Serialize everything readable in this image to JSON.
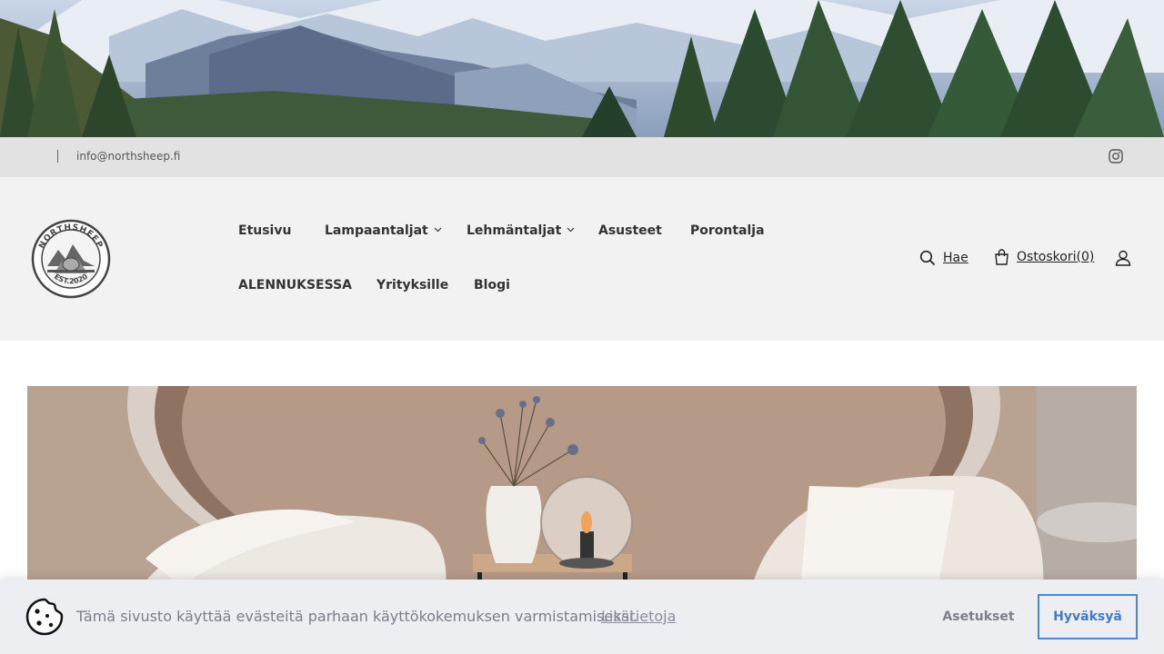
{
  "topbar": {
    "email": "info@northsheep.fi",
    "instagram_icon": "instagram-icon"
  },
  "logo": {
    "top_text": "NORTHSHEEP",
    "bottom_text": "EST.2020"
  },
  "nav": {
    "items": [
      {
        "label": "Etusivu"
      },
      {
        "label": "Lampaantaljat"
      },
      {
        "label": "Lehmäntaljat"
      },
      {
        "label": "Asusteet"
      },
      {
        "label": "Porontalja"
      },
      {
        "label": "ALENNUKSESSA"
      },
      {
        "label": "Yrityksille"
      },
      {
        "label": "Blogi"
      }
    ]
  },
  "tools": {
    "search_label": "Hae",
    "cart_label": "Ostoskori(0)"
  },
  "cookie": {
    "message": "Tämä sivusto käyttää evästeitä parhaan käyttökokemuksen varmistamiseksi.",
    "more_link": "Lisätietoja",
    "settings_button": "Asetukset",
    "accept_button": "Hyväksyä"
  },
  "colors": {
    "topbar_bg": "#e2e2e2",
    "header_bg": "#f2f2f2",
    "cookie_bg": "#edeef2",
    "accent": "#4a85d6"
  }
}
